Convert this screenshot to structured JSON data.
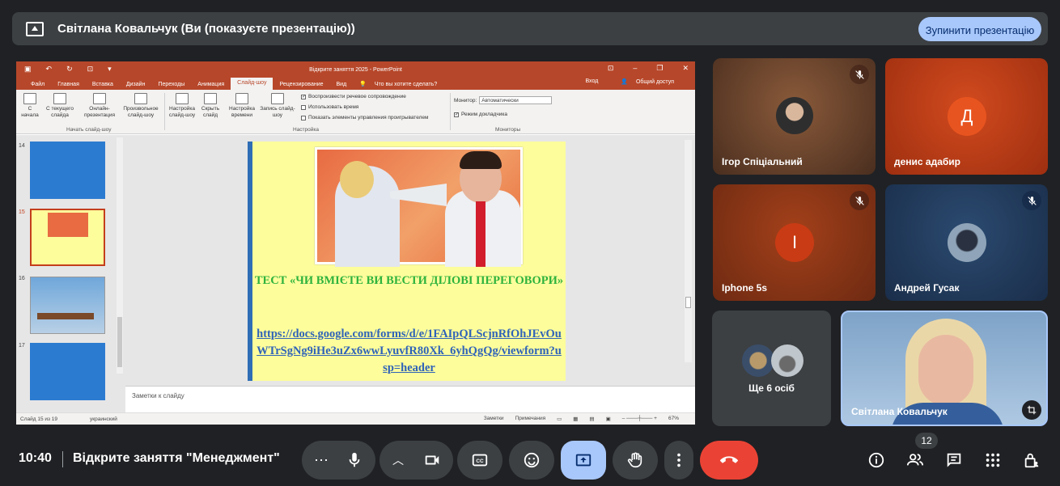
{
  "banner": {
    "title": "Світлана Ковальчук (Ви (показуєте презентацію))",
    "stop_button": "Зупинити презентацію"
  },
  "powerpoint": {
    "window_title": "Відкрите заняття 2025 - PowerPoint",
    "tabs": [
      "Файл",
      "Главная",
      "Вставка",
      "Дизайн",
      "Переходы",
      "Анимация",
      "Слайд-шоу",
      "Рецензирование",
      "Вид"
    ],
    "tell_me": "Что вы хотите сделать?",
    "login": "Вход",
    "share": "Общий доступ",
    "ribbon": {
      "from_start": "С начала",
      "from_current": "С текущего слайда",
      "online": "Онлайн-презентация",
      "custom": "Произвольное слайд-шоу",
      "group1": "Начать слайд-шоу",
      "setup": "Настройка слайд-шоу",
      "hide": "Скрыть слайд",
      "timing": "Настройка времени",
      "record": "Запись слайд-шоу",
      "chk_narration": "Воспроизвести речевое сопровождение",
      "chk_timings": "Использовать время",
      "chk_controls": "Показать элементы управления проигрывателем",
      "group2": "Настройка",
      "monitor_label": "Монитор:",
      "monitor_value": "Автоматически",
      "presenter_view": "Режим докладчика",
      "group3": "Мониторы"
    },
    "thumb_numbers": [
      "14",
      "15",
      "16",
      "17"
    ],
    "slide": {
      "test_title": "ТЕСТ «ЧИ ВМІЄТЕ ВИ ВЕСТИ ДІЛОВІ ПЕРЕГОВОРИ»",
      "link": "https://docs.google.com/forms/d/e/1FAIpQLScjnRfOhJEvOuWTrSgNg9iHe3uZx6wwLyuvfR80Xk_6yhQgQg/viewform?usp=header"
    },
    "notes_placeholder": "Заметки к слайду",
    "status": {
      "slide_of": "Слайд 15 из 19",
      "language": "украинский",
      "notes_btn": "Заметки",
      "comments_btn": "Примечания",
      "zoom": "67%"
    }
  },
  "participants": [
    {
      "name": "Ігор Спіціальний",
      "muted": true
    },
    {
      "name": "денис адабир",
      "initial": "Д",
      "muted": false
    },
    {
      "name": "Iphone 5s",
      "initial": "I",
      "muted": true
    },
    {
      "name": "Андрей Гусак",
      "muted": true
    },
    {
      "name": "Ще 6 осіб"
    },
    {
      "name": "Світлана Ковальчук"
    }
  ],
  "bottom": {
    "time": "10:40",
    "meeting_name": "Відкрите заняття \"Менеджмент\"",
    "people_count": "12"
  },
  "colors": {
    "accent": "#a8c7fa",
    "end_call": "#ea4335",
    "ppt": "#b7472a",
    "tile_brown": "#7a3b1c",
    "tile_red": "#c53a12"
  }
}
